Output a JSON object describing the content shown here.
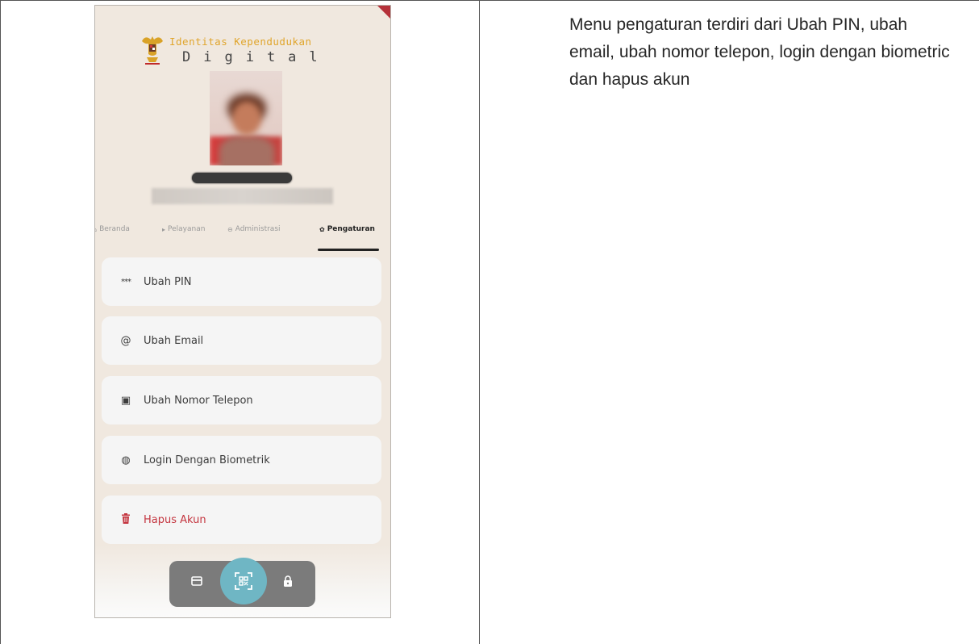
{
  "app": {
    "brand_title": "Identitas Kependudukan",
    "brand_subtitle": "Digital"
  },
  "tabs": [
    {
      "label": "Beranda",
      "icon": "home-icon",
      "active": false
    },
    {
      "label": "Pelayanan",
      "icon": "service-icon",
      "active": false
    },
    {
      "label": "Administrasi",
      "icon": "admin-icon",
      "active": false
    },
    {
      "label": "Pengaturan",
      "icon": "gear-icon",
      "active": true
    }
  ],
  "menu": [
    {
      "label": "Ubah PIN",
      "icon": "pin-dots-icon",
      "glyph": "***"
    },
    {
      "label": "Ubah Email",
      "icon": "at-icon",
      "glyph": "@"
    },
    {
      "label": "Ubah Nomor Telepon",
      "icon": "sim-card-icon",
      "glyph": "▣"
    },
    {
      "label": "Login Dengan Biometrik",
      "icon": "fingerprint-icon",
      "glyph": "◍"
    },
    {
      "label": "Hapus Akun",
      "icon": "trash-icon",
      "glyph": "🗑"
    }
  ],
  "bottom_nav": [
    {
      "icon": "card-icon"
    },
    {
      "icon": "qr-scan-icon"
    },
    {
      "icon": "lock-icon"
    }
  ],
  "colors": {
    "background": "#f0e8df",
    "accent_teal": "#6fb6c4",
    "danger": "#c4353f",
    "brand_gold": "#e0a52c"
  },
  "description": "Menu pengaturan terdiri dari Ubah PIN, ubah email, ubah nomor telepon, login dengan biometric dan hapus akun"
}
